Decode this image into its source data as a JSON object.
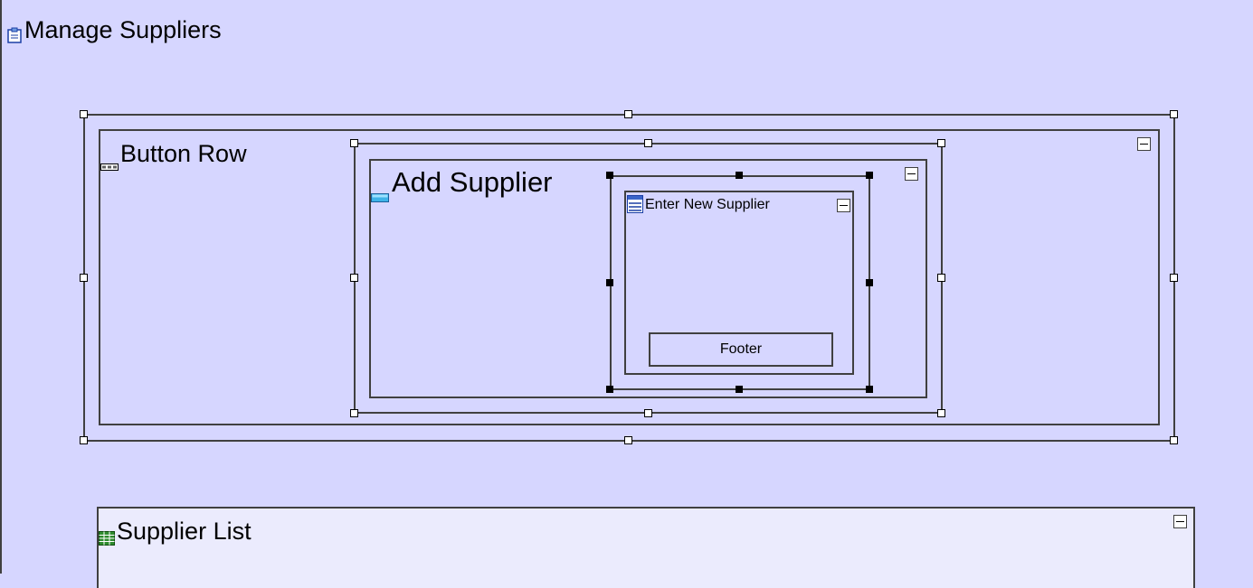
{
  "page": {
    "title": "Manage Suppliers"
  },
  "button_row": {
    "title": "Button Row"
  },
  "add_supplier": {
    "title": "Add Supplier"
  },
  "enter_new_supplier": {
    "title": "Enter New Supplier",
    "footer": "Footer"
  },
  "supplier_list": {
    "title": "Supplier List"
  },
  "icons": {
    "page": "clipboard-icon",
    "button_row": "button-row-icon",
    "add_supplier": "popup-icon",
    "enter_new_supplier": "form-icon",
    "supplier_list": "table-icon",
    "collapse": "minus-icon"
  },
  "colors": {
    "background": "#d6d6ff",
    "list_background": "#ebebfd",
    "border": "#404040",
    "handle_fill": "#ffffff",
    "selected_handle": "#000000"
  }
}
